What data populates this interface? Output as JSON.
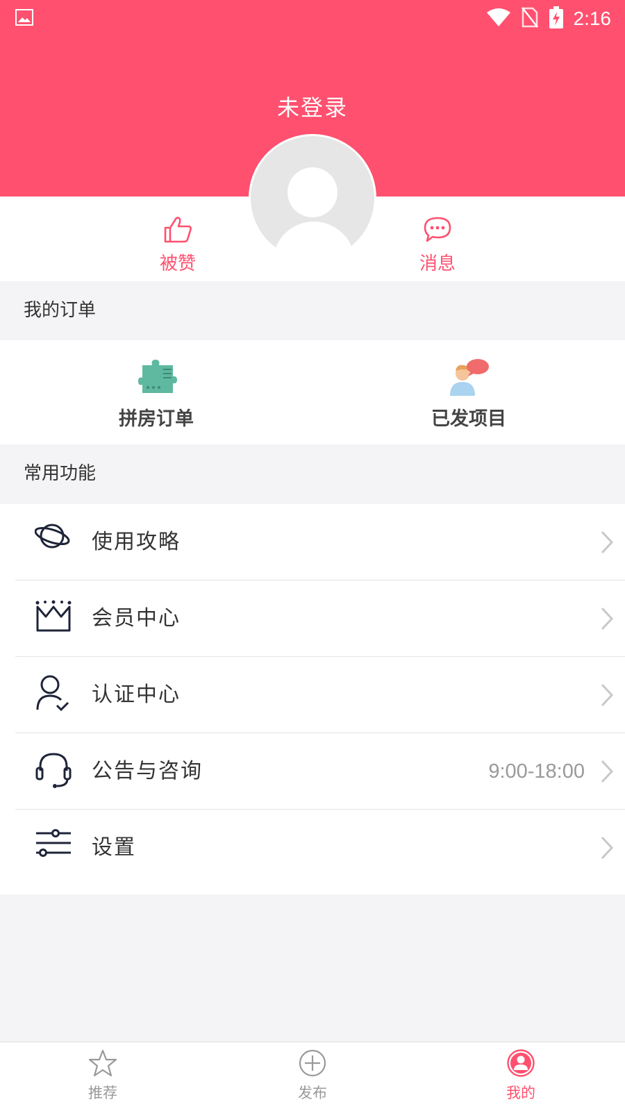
{
  "status": {
    "time": "2:16"
  },
  "header": {
    "title": "未登录"
  },
  "stats": {
    "likes_label": "被赞",
    "messages_label": "消息"
  },
  "orders_section": {
    "title": "我的订单",
    "items": [
      {
        "label": "拼房订单",
        "icon": "puzzle-piece-icon"
      },
      {
        "label": "已发项目",
        "icon": "person-chat-icon"
      }
    ]
  },
  "functions_section": {
    "title": "常用功能",
    "items": [
      {
        "label": "使用攻略",
        "icon": "planet-icon",
        "extra": ""
      },
      {
        "label": "会员中心",
        "icon": "crown-icon",
        "extra": ""
      },
      {
        "label": "认证中心",
        "icon": "user-check-icon",
        "extra": ""
      },
      {
        "label": "公告与咨询",
        "icon": "headset-icon",
        "extra": "9:00-18:00"
      },
      {
        "label": "设置",
        "icon": "sliders-icon",
        "extra": ""
      }
    ]
  },
  "tabbar": {
    "tabs": [
      {
        "label": "推荐",
        "icon": "star-icon"
      },
      {
        "label": "发布",
        "icon": "plus-circle-icon"
      },
      {
        "label": "我的",
        "icon": "user-circle-icon",
        "active": true
      }
    ]
  },
  "colors": {
    "accent": "#ff506f",
    "background": "#f4f4f6"
  }
}
